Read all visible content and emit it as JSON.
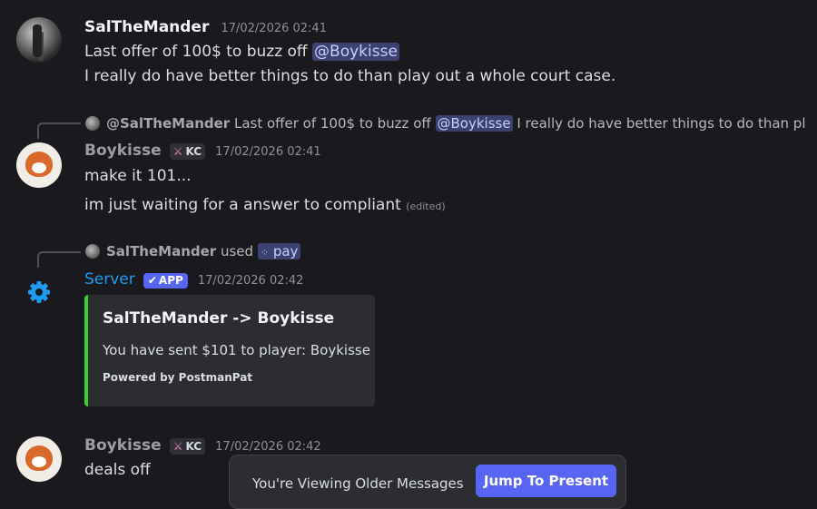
{
  "messages": [
    {
      "username": "SalTheMander",
      "timestamp": "17/02/2026 02:41",
      "line1_text": "Last offer of 100$ to buzz off",
      "line1_mention": "@Boykisse",
      "line2_text": "I really do have better things to do than play out a whole court case."
    },
    {
      "reply": {
        "username": "@SalTheMander",
        "text_before": "Last offer of 100$ to buzz off",
        "mention": "@Boykisse",
        "text_after": "I really do have better things to do than pl..."
      },
      "username": "Boykisse",
      "badge": "KC",
      "timestamp": "17/02/2026 02:41",
      "line1_text": "make it 101...",
      "line2_text": "im just waiting for a answer to compliant",
      "edited": "(edited)"
    },
    {
      "interaction": {
        "username": "SalTheMander",
        "used": "used",
        "command": "pay"
      },
      "username": "Server",
      "app_badge": "APP",
      "timestamp": "17/02/2026 02:42",
      "embed": {
        "title": "SalTheMander -> Boykisse",
        "description": "You have sent $101 to player: Boykisse",
        "footer": "Powered by PostmanPat",
        "color": "#3ad22c"
      }
    },
    {
      "username": "Boykisse",
      "badge": "KC",
      "timestamp": "17/02/2026 02:42",
      "line1_text": "deals off"
    }
  ],
  "banner": {
    "text": "You're Viewing Older Messages",
    "button": "Jump To Present"
  },
  "colors": {
    "background": "#1a1a1e",
    "accent": "#5865f2",
    "mention_bg": "#3c4270",
    "server_name": "#1e9bf2"
  }
}
